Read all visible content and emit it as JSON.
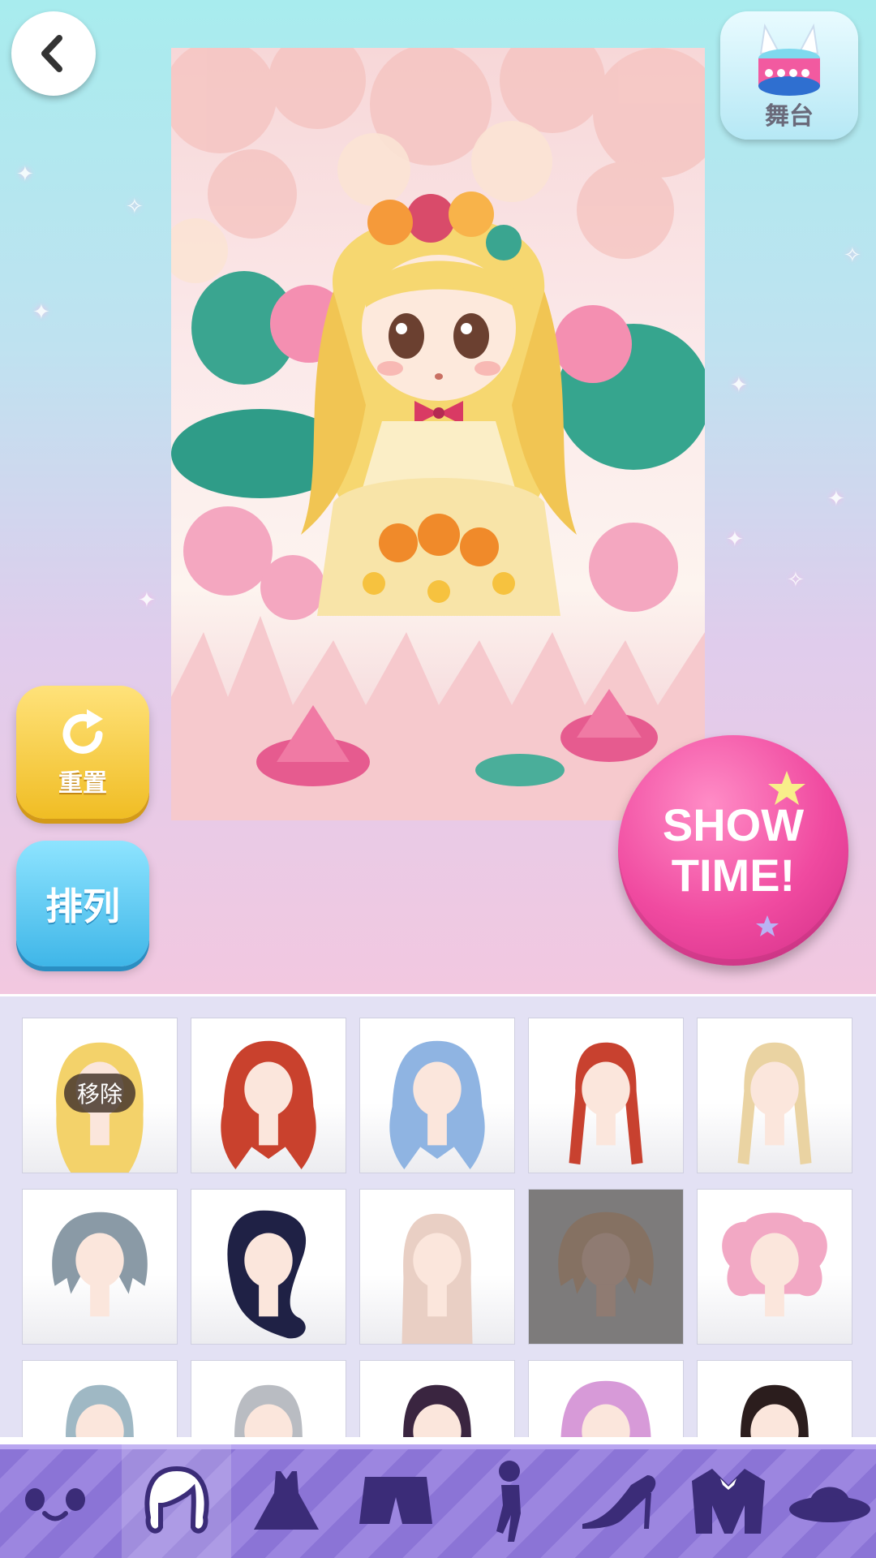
{
  "header": {
    "back_icon": "chevron-left-icon",
    "stage_button": {
      "label": "舞台",
      "icon": "drum-stage-icon"
    }
  },
  "preview": {
    "subject": "dress-up-character-illustration"
  },
  "side_buttons": {
    "reset": {
      "label": "重置",
      "icon": "refresh-icon"
    },
    "sort": {
      "label": "排列"
    }
  },
  "show_time": {
    "label": "SHOW\nTIME!"
  },
  "hair_items": [
    {
      "color": "#f3d26a",
      "style": "long-wavy",
      "selected": true,
      "badge": "移除"
    },
    {
      "color": "#c9412d",
      "style": "long-curly"
    },
    {
      "color": "#8fb4e2",
      "style": "long-curly"
    },
    {
      "color": "#c8412f",
      "style": "twin-braids"
    },
    {
      "color": "#ead3a2",
      "style": "twin-braids"
    },
    {
      "color": "#8a9aa6",
      "style": "short-messy"
    },
    {
      "color": "#1f2145",
      "style": "side-wave"
    },
    {
      "color": "#e9cfc4",
      "style": "long-straight"
    },
    {
      "color": "#8a6a52",
      "style": "short-messy",
      "dimmed": true
    },
    {
      "color": "#f2a8c4",
      "style": "twin-buns"
    },
    {
      "color": "#9fb8c4",
      "style": "long-straight"
    },
    {
      "color": "#b9bcc2",
      "style": "long-straight"
    },
    {
      "color": "#3a2540",
      "style": "long-straight"
    },
    {
      "color": "#d79ad8",
      "style": "bob"
    },
    {
      "color": "#2b1d1d",
      "style": "long-straight"
    }
  ],
  "nav": {
    "items": [
      {
        "id": "face",
        "icon": "face-icon"
      },
      {
        "id": "hair",
        "icon": "hair-icon",
        "active": true
      },
      {
        "id": "dress",
        "icon": "dress-icon"
      },
      {
        "id": "bottoms",
        "icon": "shorts-icon"
      },
      {
        "id": "pose",
        "icon": "pose-figure-icon"
      },
      {
        "id": "shoes",
        "icon": "high-heel-icon"
      },
      {
        "id": "outerwear",
        "icon": "jacket-icon"
      },
      {
        "id": "hat",
        "icon": "hat-icon"
      }
    ]
  },
  "colors": {
    "accent_pink": "#f04aa0",
    "reset_yellow": "#f0bd24",
    "sort_blue": "#3fb6e8",
    "nav_purple": "#8b74d6"
  }
}
